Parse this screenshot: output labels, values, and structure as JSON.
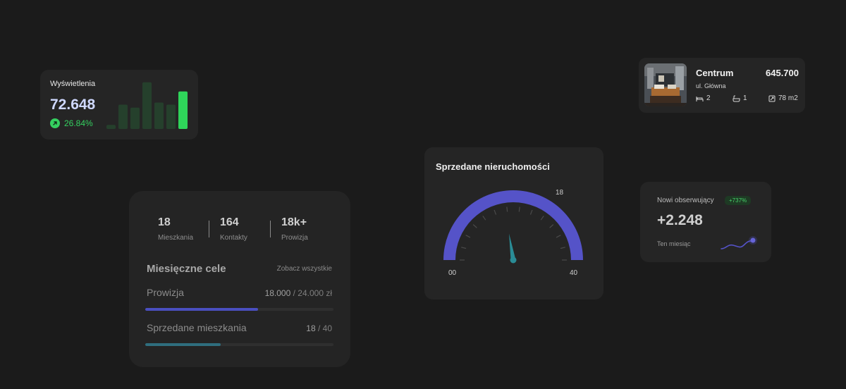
{
  "views": {
    "title": "Wyświetlenia",
    "value": "72.648",
    "change": "26.84%",
    "bars": [
      0.08,
      0.48,
      0.42,
      0.92,
      0.52,
      0.48,
      0.74
    ]
  },
  "property": {
    "name": "Centrum",
    "price": "645.700",
    "street": "ul. Główna",
    "bedrooms": "2",
    "bathrooms": "1",
    "area": "78 m2"
  },
  "stats": {
    "items": [
      {
        "value": "18",
        "label": "Mieszkania"
      },
      {
        "value": "164",
        "label": "Kontakty"
      },
      {
        "value": "18k+",
        "label": "Prowizja"
      }
    ],
    "goals_title": "Miesięczne cele",
    "see_all": "Zobacz wszystkie",
    "goals": [
      {
        "label": "Prowizja",
        "current": "18.000",
        "total": " / 24.000 zł",
        "progress": 0.6,
        "color": "#4a4fc0"
      },
      {
        "label": "Sprzedane mieszkania",
        "current": "18",
        "total": " / 40",
        "progress": 0.4,
        "color": "#2f6e7e"
      }
    ]
  },
  "gauge": {
    "title": "Sprzedane nieruchomości",
    "value_label": "18",
    "min_label": "00",
    "max_label": "40",
    "value": 18,
    "min": 0,
    "max": 40,
    "arc_color": "#5553c8",
    "needle_color": "#2a8c96"
  },
  "followers": {
    "title": "Nowi obserwujący",
    "badge": "+737%",
    "value": "+2.248",
    "period": "Ten miesiąc",
    "accent": "#5553c8"
  }
}
